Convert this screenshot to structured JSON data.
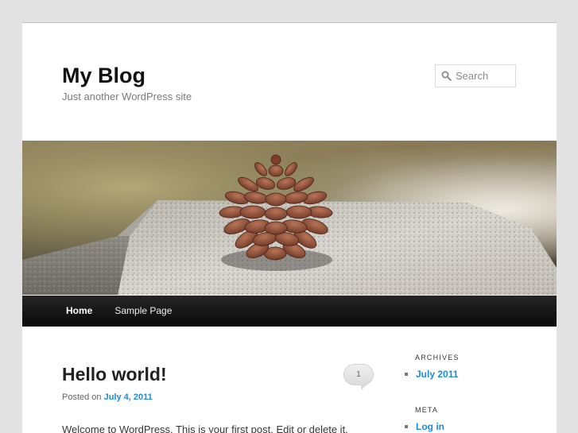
{
  "header": {
    "site_title": "My Blog",
    "tagline": "Just another WordPress site",
    "search_placeholder": "Search"
  },
  "nav": {
    "items": [
      {
        "label": "Home",
        "current": true
      },
      {
        "label": "Sample Page",
        "current": false
      }
    ]
  },
  "post": {
    "title": "Hello world!",
    "comment_count": "1",
    "posted_on_label": "Posted on",
    "date": "July 4, 2011",
    "excerpt": "Welcome to WordPress. This is your first post. Edit or delete it,"
  },
  "sidebar": {
    "archives": {
      "title": "ARCHIVES",
      "items": [
        "July 2011"
      ]
    },
    "meta": {
      "title": "META",
      "items": [
        "Log in"
      ]
    }
  },
  "colors": {
    "link": "#1b8be0",
    "nav_background": "#1a1a1a",
    "page_background": "#e2e2e2"
  },
  "icons": {
    "search": "search-icon"
  }
}
